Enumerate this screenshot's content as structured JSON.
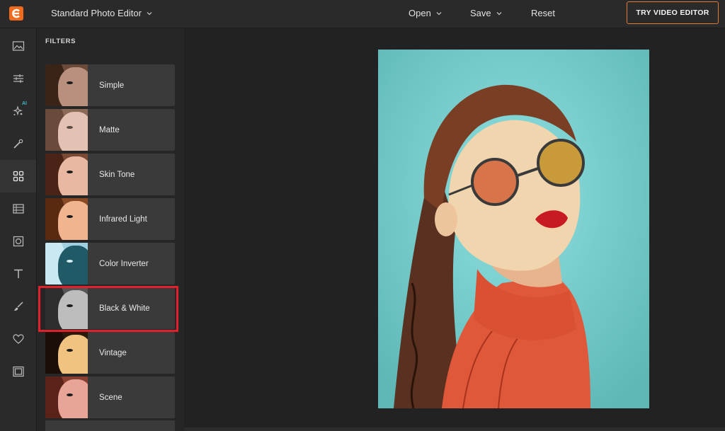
{
  "header": {
    "app_title": "Standard Photo Editor",
    "menu": {
      "open": "Open",
      "save": "Save",
      "reset": "Reset"
    },
    "try_button": "TRY VIDEO EDITOR",
    "logo_color": "#f26b1d",
    "accent_color": "#e07b3a"
  },
  "iconbar": {
    "ai_badge": "AI",
    "items": [
      "image-icon",
      "sliders-icon",
      "ai-sparkle-icon",
      "magic-wand-icon",
      "filters-grid-icon",
      "texture-icon",
      "frame-icon",
      "text-icon",
      "brush-icon",
      "heart-icon",
      "border-icon"
    ],
    "active": "filters-grid-icon"
  },
  "filters_panel": {
    "title": "FILTERS",
    "items": [
      {
        "label": "Simple"
      },
      {
        "label": "Matte"
      },
      {
        "label": "Skin Tone"
      },
      {
        "label": "Infrared Light"
      },
      {
        "label": "Color Inverter"
      },
      {
        "label": "Black & White"
      },
      {
        "label": "Vintage"
      },
      {
        "label": "Scene"
      }
    ],
    "highlighted": "Black & White",
    "highlight_color": "#e0202a"
  },
  "canvas": {
    "background_color": "#6fc8c6"
  }
}
